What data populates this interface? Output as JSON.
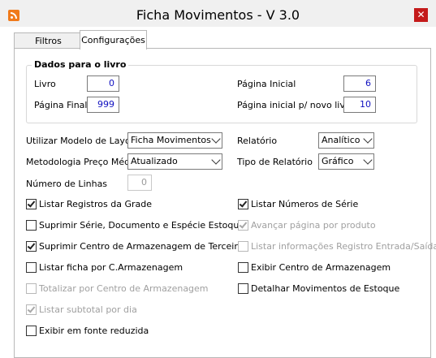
{
  "window": {
    "title": "Ficha Movimentos - V 3.0",
    "icon": "rss-like-app-icon",
    "close": "✕"
  },
  "tabs": [
    {
      "label": "Filtros",
      "active": false
    },
    {
      "label": "Configurações",
      "active": true
    }
  ],
  "dados_livro": {
    "legend": "Dados para o livro",
    "livro": {
      "label": "Livro",
      "value": "0"
    },
    "pagina_final": {
      "label": "Página Final",
      "value": "999"
    },
    "pagina_inicial": {
      "label": "Página Inicial",
      "value": "6"
    },
    "pagina_inicial_novo": {
      "label": "Página inicial p/ novo livro",
      "value": "10"
    }
  },
  "options": {
    "modelo_layout": {
      "label": "Utilizar Modelo de Layout",
      "value": "Ficha Movimentos"
    },
    "metodologia": {
      "label": "Metodologia Preço Médio",
      "value": "Atualizado"
    },
    "relatorio": {
      "label": "Relatório",
      "value": "Analítico"
    },
    "tipo_relatorio": {
      "label": "Tipo de Relatório",
      "value": "Gráfico"
    },
    "numero_linhas": {
      "label": "Número de Linhas",
      "value": "0"
    }
  },
  "checkboxes": {
    "listar_registros_grade": {
      "label": "Listar Registros da Grade",
      "checked": true
    },
    "suprimir_serie": {
      "label": "Suprimir Série, Documento e Espécie Estoque",
      "checked": false
    },
    "suprimir_centro": {
      "label": "Suprimir Centro de Armazenagem de Terceiros",
      "checked": true
    },
    "listar_ficha_centro": {
      "label": "Listar ficha por C.Armazenagem",
      "checked": false
    },
    "totalizar_centro": {
      "label": "Totalizar por Centro de Armazenagem",
      "checked": false
    },
    "listar_subtotal": {
      "label": "Listar subtotal por dia",
      "checked": true
    },
    "exibir_fonte_reduzida": {
      "label": "Exibir em fonte reduzida",
      "checked": false
    },
    "listar_numeros_serie": {
      "label": "Listar Números de Série",
      "checked": true
    },
    "avancar_pagina": {
      "label": "Avançar página por produto",
      "checked": true
    },
    "listar_informacoes": {
      "label": "Listar informações Registro Entrada/Saída",
      "checked": false
    },
    "exibir_centro": {
      "label": "Exibir Centro de Armazenagem",
      "checked": false
    },
    "detalhar_movimentos": {
      "label": "Detalhar Movimentos de Estoque",
      "checked": false
    }
  }
}
